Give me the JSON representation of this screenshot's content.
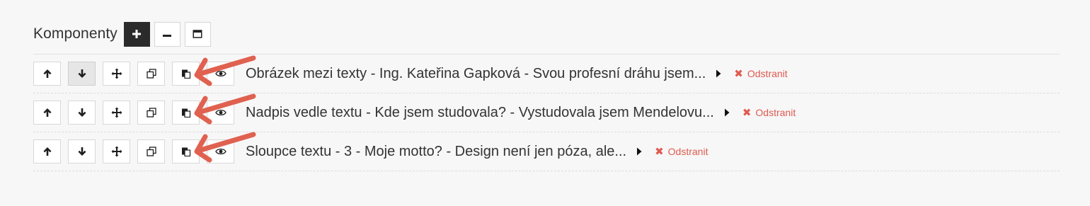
{
  "header": {
    "title": "Komponenty"
  },
  "icons": {
    "add": "plus-icon",
    "collapse": "minus-icon",
    "expand_all": "window-icon",
    "move_up": "arrow-up-icon",
    "move_down": "arrow-down-icon",
    "drag": "move-icon",
    "duplicate": "clone-icon",
    "paste": "paste-icon",
    "visibility": "eye-icon",
    "expand_row": "caret-right-icon",
    "remove": "x-icon"
  },
  "colors": {
    "remove_red": "#e05a4f",
    "annotation_arrow": "#e0614f",
    "dark_button": "#2b2b2b"
  },
  "components": [
    {
      "title": "Obrázek mezi texty - Ing. Kateřina Gapková - Svou profesní dráhu jsem...",
      "remove_label": "Odstranit"
    },
    {
      "title": "Nadpis vedle textu - Kde jsem studovala? - Vystudovala jsem Mendelovu...",
      "remove_label": "Odstranit"
    },
    {
      "title": "Sloupce textu - 3 - Moje motto? - Design není jen póza, ale...",
      "remove_label": "Odstranit"
    }
  ]
}
